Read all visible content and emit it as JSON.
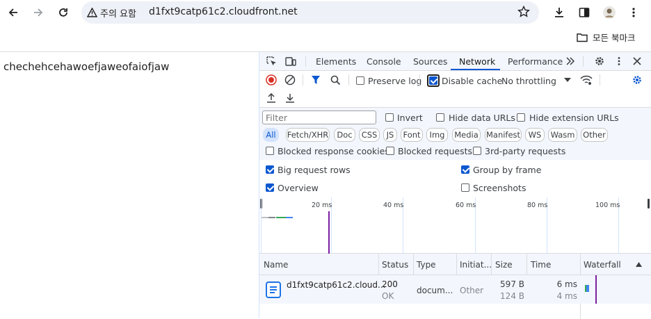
{
  "browser": {
    "security_chip": "주의 요함",
    "url": "d1fxt9catp61c2.cloudfront.net",
    "bookmark_folder": "모든 북마크"
  },
  "page": {
    "text": "chechehcehawoefjaweofaiofjaw"
  },
  "devtools": {
    "tabs": [
      "Elements",
      "Console",
      "Sources",
      "Network",
      "Performance"
    ],
    "active_tab": "Network",
    "toolbar": {
      "preserve_log": "Preserve log",
      "disable_cache": "Disable cache",
      "throttling": "No throttling"
    },
    "filter": {
      "placeholder": "Filter",
      "invert": "Invert",
      "hide_data_urls": "Hide data URLs",
      "hide_extension_urls": "Hide extension URLs",
      "types": [
        "All",
        "Fetch/XHR",
        "Doc",
        "CSS",
        "JS",
        "Font",
        "Img",
        "Media",
        "Manifest",
        "WS",
        "Wasm",
        "Other"
      ],
      "blocked_response_cookies": "Blocked response cookies",
      "blocked_requests": "Blocked requests",
      "third_party_requests": "3rd-party requests"
    },
    "settings": {
      "big_request_rows": "Big request rows",
      "group_by_frame": "Group by frame",
      "overview": "Overview",
      "screenshots": "Screenshots"
    },
    "overview_ticks": [
      "20 ms",
      "40 ms",
      "60 ms",
      "80 ms",
      "100 ms"
    ],
    "table": {
      "columns": [
        "Name",
        "Status",
        "Type",
        "Initiat...",
        "Size",
        "Time",
        "Waterfall"
      ],
      "rows": [
        {
          "name": "d1fxt9catp61c2.cloud...",
          "status": "200",
          "status_text": "OK",
          "type": "docum...",
          "initiator": "Other",
          "size": "597 B",
          "size_resource": "124 B",
          "time": "6 ms",
          "time_latency": "4 ms"
        }
      ]
    }
  },
  "colors": {
    "accent": "#0b57d0",
    "record_red": "#d93025",
    "panel_bg": "#f3f6fc"
  }
}
